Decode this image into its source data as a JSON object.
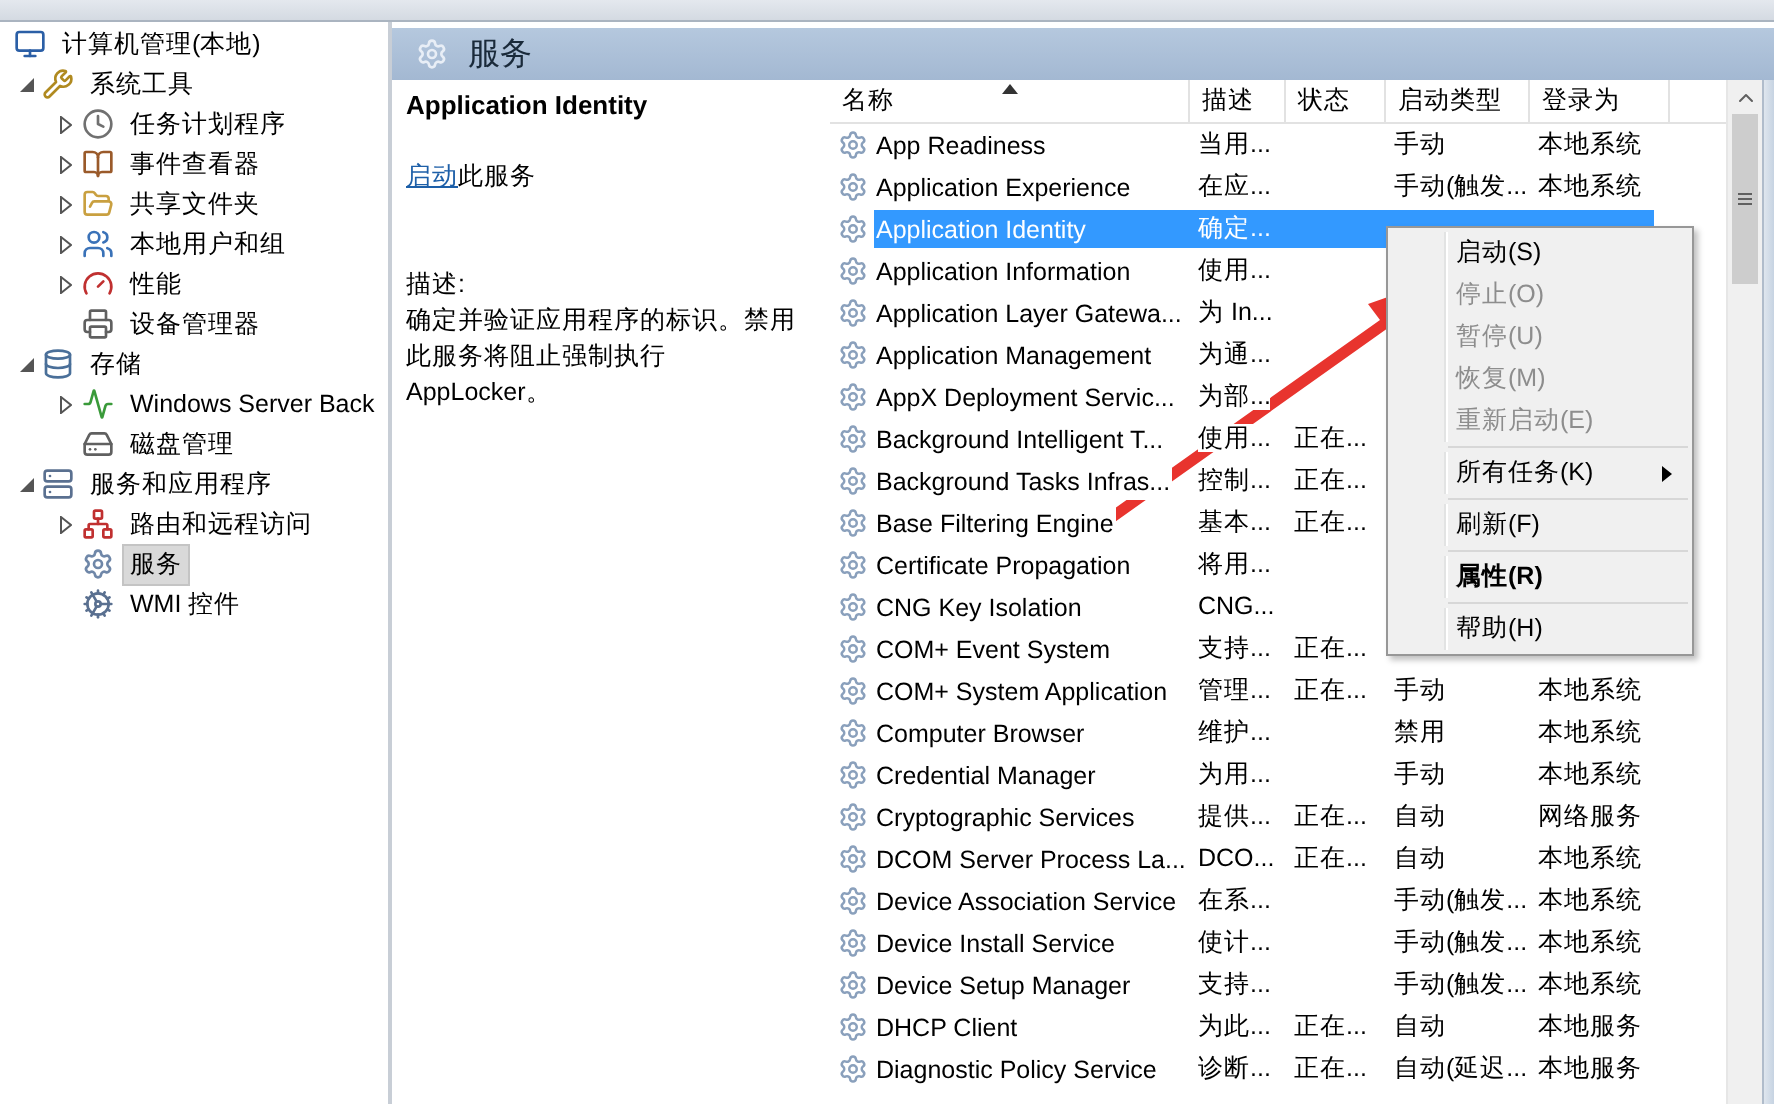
{
  "tree": {
    "items": [
      {
        "label": "计算机管理(本地)",
        "kind": "root",
        "selected": false,
        "children": [
          {
            "label": "系统工具",
            "kind": "folder",
            "expanded": true,
            "selected": false,
            "children": [
              {
                "label": "任务计划程序",
                "kind": "folder",
                "expanded": false,
                "selected": false
              },
              {
                "label": "事件查看器",
                "kind": "folder",
                "expanded": false,
                "selected": false
              },
              {
                "label": "共享文件夹",
                "kind": "folder",
                "expanded": false,
                "selected": false
              },
              {
                "label": "本地用户和组",
                "kind": "folder",
                "expanded": false,
                "selected": false
              },
              {
                "label": "性能",
                "kind": "folder",
                "expanded": false,
                "selected": false
              },
              {
                "label": "设备管理器",
                "kind": "leaf",
                "selected": false
              }
            ]
          },
          {
            "label": "存储",
            "kind": "folder",
            "expanded": true,
            "selected": false,
            "children": [
              {
                "label": "Windows Server Back",
                "kind": "folder",
                "expanded": false,
                "selected": false
              },
              {
                "label": "磁盘管理",
                "kind": "leaf",
                "selected": false
              }
            ]
          },
          {
            "label": "服务和应用程序",
            "kind": "folder",
            "expanded": true,
            "selected": false,
            "children": [
              {
                "label": "路由和远程访问",
                "kind": "folder",
                "expanded": false,
                "selected": false
              },
              {
                "label": "服务",
                "kind": "leaf",
                "selected": true
              },
              {
                "label": "WMI 控件",
                "kind": "leaf",
                "selected": false
              }
            ]
          }
        ]
      }
    ]
  },
  "header": {
    "title": "服务"
  },
  "details": {
    "title": "Application Identity",
    "action_link": "启动",
    "action_text": "此服务",
    "description_label": "描述:",
    "description": "确定并验证应用程序的标识。禁用此服务将阻止强制执行 AppLocker。"
  },
  "table": {
    "columns": [
      {
        "label": "名称",
        "sorted": true
      },
      {
        "label": "描述",
        "sorted": false
      },
      {
        "label": "状态",
        "sorted": false
      },
      {
        "label": "启动类型",
        "sorted": false
      },
      {
        "label": "登录为",
        "sorted": false
      }
    ],
    "rows": [
      {
        "name": "App Readiness",
        "description": "当用...",
        "startup": "手动",
        "logon": "本地系统",
        "selected": false
      },
      {
        "name": "Application Experience",
        "description": "在应...",
        "startup": "手动(触发...",
        "logon": "本地系统",
        "selected": false
      },
      {
        "name": "Application Identity",
        "description": "确定...",
        "selected": true
      },
      {
        "name": "Application Information",
        "description": "使用...",
        "selected": false
      },
      {
        "name": "Application Layer Gatewa...",
        "description": "为 In...",
        "selected": false
      },
      {
        "name": "Application Management",
        "description": "为通...",
        "selected": false
      },
      {
        "name": "AppX Deployment Servic...",
        "description": "为部...",
        "selected": false
      },
      {
        "name": "Background Intelligent T...",
        "description": "使用...",
        "status": "正在...",
        "selected": false
      },
      {
        "name": "Background Tasks Infras...",
        "description": "控制...",
        "status": "正在...",
        "selected": false
      },
      {
        "name": "Base Filtering Engine",
        "description": "基本...",
        "status": "正在...",
        "selected": false
      },
      {
        "name": "Certificate Propagation",
        "description": "将用...",
        "selected": false
      },
      {
        "name": "CNG Key Isolation",
        "description": "CNG...",
        "selected": false
      },
      {
        "name": "COM+ Event System",
        "description": "支持...",
        "status": "正在...",
        "selected": false
      },
      {
        "name": "COM+ System Application",
        "description": "管理...",
        "status": "正在...",
        "startup": "手动",
        "logon": "本地系统",
        "selected": false
      },
      {
        "name": "Computer Browser",
        "description": "维护...",
        "startup": "禁用",
        "logon": "本地系统",
        "selected": false
      },
      {
        "name": "Credential Manager",
        "description": "为用...",
        "startup": "手动",
        "logon": "本地系统",
        "selected": false
      },
      {
        "name": "Cryptographic Services",
        "description": "提供...",
        "status": "正在...",
        "startup": "自动",
        "logon": "网络服务",
        "selected": false
      },
      {
        "name": "DCOM Server Process La...",
        "description": "DCO...",
        "status": "正在...",
        "startup": "自动",
        "logon": "本地系统",
        "selected": false
      },
      {
        "name": "Device Association Service",
        "description": "在系...",
        "startup": "手动(触发...",
        "logon": "本地系统",
        "selected": false
      },
      {
        "name": "Device Install Service",
        "description": "使计...",
        "startup": "手动(触发...",
        "logon": "本地系统",
        "selected": false
      },
      {
        "name": "Device Setup Manager",
        "description": "支持...",
        "startup": "手动(触发...",
        "logon": "本地系统",
        "selected": false
      },
      {
        "name": "DHCP Client",
        "description": "为此...",
        "status": "正在...",
        "startup": "自动",
        "logon": "本地服务",
        "selected": false
      },
      {
        "name": "Diagnostic Policy Service",
        "description": "诊断...",
        "status": "正在...",
        "startup": "自动(延迟...",
        "logon": "本地服务",
        "selected": false
      }
    ]
  },
  "context_menu": {
    "items": [
      {
        "kind": "item",
        "label": "启动(S)",
        "disabled": false,
        "default": false,
        "submenu": false
      },
      {
        "kind": "item",
        "label": "停止(O)",
        "disabled": true,
        "default": false,
        "submenu": false
      },
      {
        "kind": "item",
        "label": "暂停(U)",
        "disabled": true,
        "default": false,
        "submenu": false
      },
      {
        "kind": "item",
        "label": "恢复(M)",
        "disabled": true,
        "default": false,
        "submenu": false
      },
      {
        "kind": "item",
        "label": "重新启动(E)",
        "disabled": true,
        "default": false,
        "submenu": false
      },
      {
        "kind": "separator"
      },
      {
        "kind": "item",
        "label": "所有任务(K)",
        "disabled": false,
        "default": false,
        "submenu": true
      },
      {
        "kind": "separator"
      },
      {
        "kind": "item",
        "label": "刷新(F)",
        "disabled": false,
        "default": false,
        "submenu": false
      },
      {
        "kind": "separator"
      },
      {
        "kind": "item",
        "label": "属性(R)",
        "disabled": false,
        "default": true,
        "submenu": false
      },
      {
        "kind": "separator"
      },
      {
        "kind": "item",
        "label": "帮助(H)",
        "disabled": false,
        "default": false,
        "submenu": false
      }
    ]
  },
  "annotation": {
    "kind": "arrow"
  }
}
